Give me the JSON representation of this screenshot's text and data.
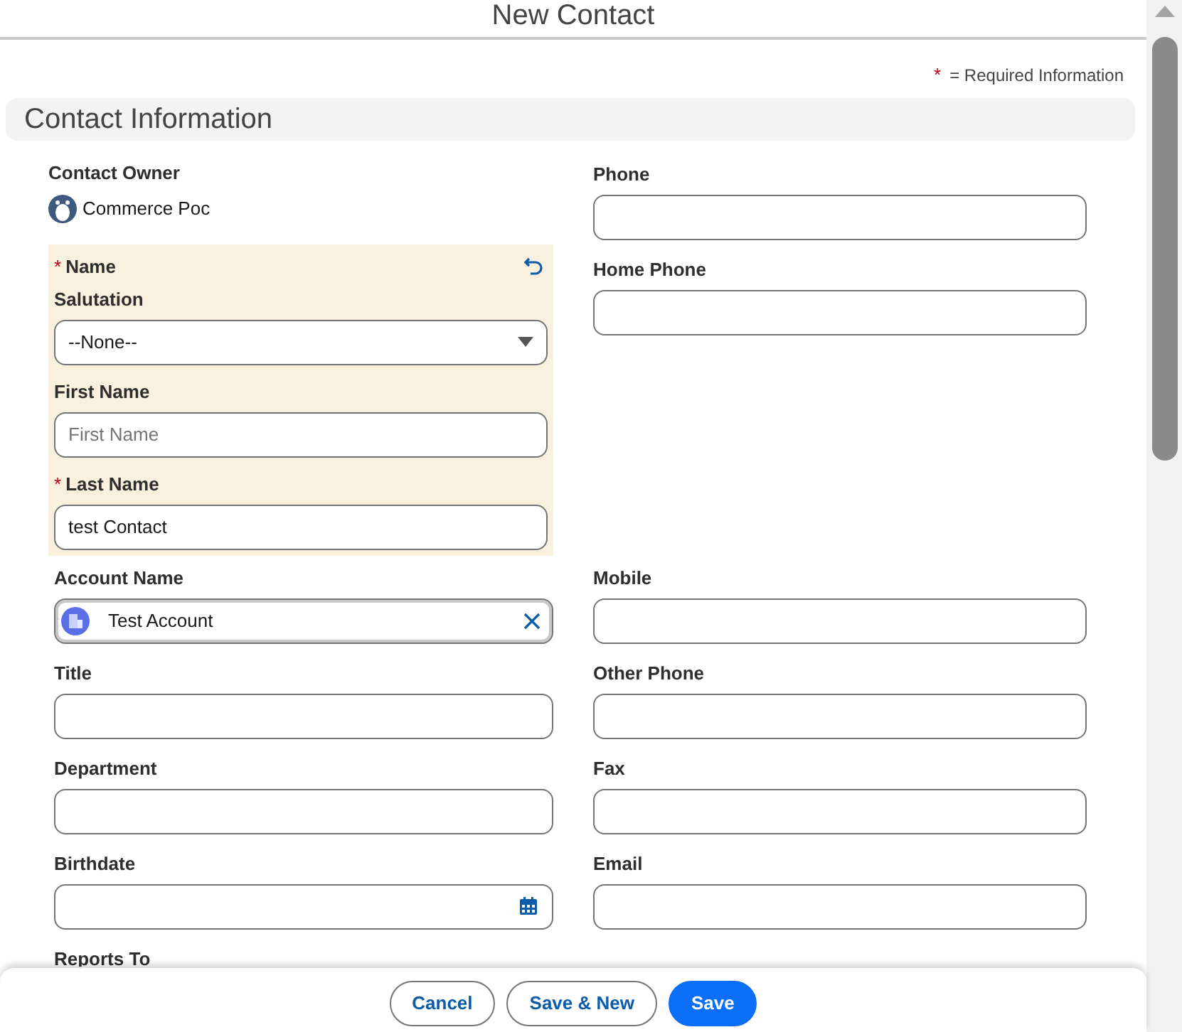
{
  "header": {
    "title": "New Contact"
  },
  "required_note": {
    "mark": "*",
    "text": "= Required Information"
  },
  "section": {
    "title": "Contact Information"
  },
  "owner": {
    "label": "Contact Owner",
    "value": "Commerce Poc"
  },
  "name_group": {
    "label": "Name",
    "required": true,
    "salutation": {
      "label": "Salutation",
      "value": "--None--"
    },
    "first_name": {
      "label": "First Name",
      "placeholder": "First Name"
    },
    "last_name": {
      "label": "Last Name",
      "required": true,
      "value": "test Contact"
    }
  },
  "right_top": [
    {
      "label": "Phone"
    },
    {
      "label": "Home Phone"
    }
  ],
  "rows": [
    [
      {
        "kind": "lookup",
        "label": "Account Name",
        "value": "Test Account"
      },
      {
        "kind": "text",
        "label": "Mobile"
      }
    ],
    [
      {
        "kind": "text",
        "label": "Title"
      },
      {
        "kind": "text",
        "label": "Other Phone"
      }
    ],
    [
      {
        "kind": "text",
        "label": "Department"
      },
      {
        "kind": "text",
        "label": "Fax"
      }
    ],
    [
      {
        "kind": "date",
        "label": "Birthdate"
      },
      {
        "kind": "text",
        "label": "Email"
      }
    ],
    [
      {
        "kind": "label_only",
        "label": "Reports To"
      }
    ]
  ],
  "footer": {
    "buttons": [
      {
        "label": "Cancel",
        "kind": "neutral"
      },
      {
        "label": "Save & New",
        "kind": "neutral"
      },
      {
        "label": "Save",
        "kind": "brand"
      }
    ]
  }
}
